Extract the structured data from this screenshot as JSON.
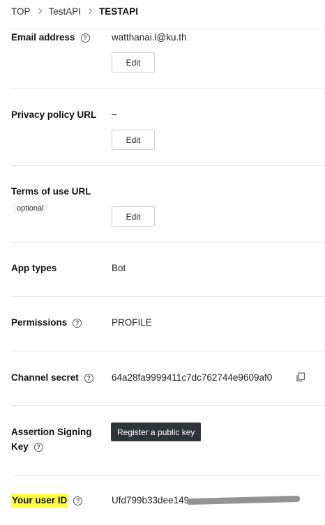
{
  "breadcrumb": {
    "items": [
      "TOP",
      "TestAPI",
      "TESTAPI"
    ]
  },
  "email": {
    "label": "Email address",
    "value": "watthanai.l@ku.th",
    "edit_label": "Edit"
  },
  "privacy": {
    "label": "Privacy policy URL",
    "value": "–",
    "edit_label": "Edit"
  },
  "terms": {
    "label": "Terms of use URL",
    "badge": "optional",
    "edit_label": "Edit"
  },
  "app_types": {
    "label": "App types",
    "value": "Bot"
  },
  "permissions": {
    "label": "Permissions",
    "value": "PROFILE"
  },
  "channel_secret": {
    "label": "Channel secret",
    "value": "64a28fa9999411c7dc762744e9609af0"
  },
  "assertion": {
    "label_line1": "Assertion Signing",
    "label_line2": "Key",
    "button_label": "Register a public key"
  },
  "user_id": {
    "label": "Your user ID",
    "value": "Ufd799b33dee149"
  },
  "colors": {
    "highlight": "#ffff40",
    "dark_button": "#2f3437",
    "divider": "#e6e6e6"
  },
  "icons": {
    "help": "help-circle-icon",
    "copy": "copy-icon",
    "separator": "chevron-right-icon"
  }
}
